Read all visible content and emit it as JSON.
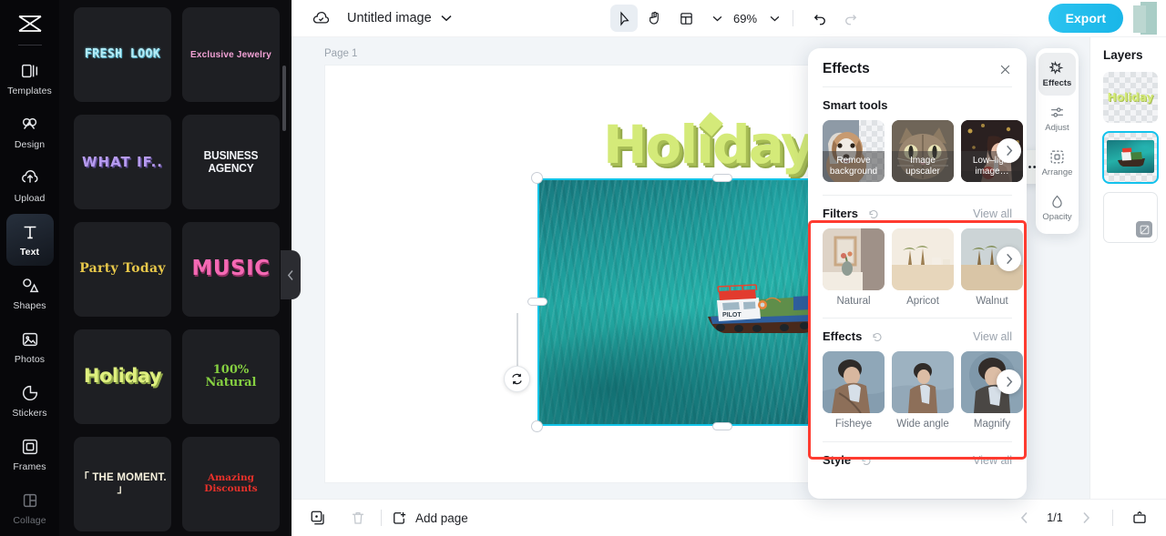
{
  "app": {
    "name": "image-editor",
    "logo_icon": "brand-logo-icon"
  },
  "sidebar": {
    "items": [
      {
        "label": "Templates",
        "icon": "templates-icon",
        "active": false
      },
      {
        "label": "Design",
        "icon": "design-icon",
        "active": false
      },
      {
        "label": "Upload",
        "icon": "upload-icon",
        "active": false
      },
      {
        "label": "Text",
        "icon": "text-icon",
        "active": true
      },
      {
        "label": "Shapes",
        "icon": "shapes-icon",
        "active": false
      },
      {
        "label": "Photos",
        "icon": "photos-icon",
        "active": false
      },
      {
        "label": "Stickers",
        "icon": "stickers-icon",
        "active": false
      },
      {
        "label": "Frames",
        "icon": "frames-icon",
        "active": false
      },
      {
        "label": "Collage",
        "icon": "collage-icon",
        "active": false
      }
    ]
  },
  "template_panel": {
    "cards": [
      {
        "text": "FRESH LOOK",
        "style": "t-fresh"
      },
      {
        "text": "Exclusive Jewelry",
        "style": "t-jewel"
      },
      {
        "text": "WHAT IF..",
        "style": "t-whatif"
      },
      {
        "text": "BUSINESS AGENCY",
        "style": "t-biz"
      },
      {
        "text": "Party Today",
        "style": "t-party"
      },
      {
        "text": "MUSIC",
        "style": "t-music"
      },
      {
        "text": "Holiday",
        "style": "t-holiday"
      },
      {
        "text": "100% Natural",
        "style": "t-natural"
      },
      {
        "text": "「 THE MOMENT. 」",
        "style": "t-moment"
      },
      {
        "text": "Amazing Discounts",
        "style": "t-discount"
      }
    ]
  },
  "topbar": {
    "cloud_icon": "cloud-save-icon",
    "title": "Untitled image",
    "title_chevron": "chevron-down-icon",
    "tools": [
      {
        "name": "select-tool",
        "icon": "cursor-icon",
        "selected": true
      },
      {
        "name": "hand-tool",
        "icon": "hand-icon",
        "selected": false
      },
      {
        "name": "layout-tool",
        "icon": "layout-icon",
        "selected": false
      }
    ],
    "zoom_level": "69%",
    "undo_icon": "undo-icon",
    "redo_icon": "redo-icon",
    "export_label": "Export",
    "shield_icon": "shield-check-icon"
  },
  "canvas": {
    "page_label": "Page 1",
    "artwork_text": "Holiday",
    "boat_text": "PILOT",
    "float_toolbar": [
      {
        "name": "crop-button",
        "icon": "crop-icon"
      },
      {
        "name": "cutout-button",
        "icon": "cutout-icon"
      },
      {
        "name": "duplicate-button",
        "icon": "duplicate-icon"
      },
      {
        "name": "more-button",
        "icon": "more-dots-icon"
      }
    ],
    "rotate_icon": "rotate-icon"
  },
  "effects_panel": {
    "title": "Effects",
    "close_icon": "close-icon",
    "sections": [
      {
        "title": "Smart tools",
        "has_reset": false,
        "view_all": null,
        "items": [
          {
            "label": "Remove background",
            "caption_overlay": true
          },
          {
            "label": "Image upscaler",
            "caption_overlay": true
          },
          {
            "label": "Low–light image…",
            "caption_overlay": true
          }
        ]
      },
      {
        "title": "Filters",
        "has_reset": true,
        "view_all": "View all",
        "items": [
          {
            "label": "Natural",
            "caption_overlay": false
          },
          {
            "label": "Apricot",
            "caption_overlay": false
          },
          {
            "label": "Walnut",
            "caption_overlay": false
          }
        ]
      },
      {
        "title": "Effects",
        "has_reset": true,
        "view_all": "View all",
        "items": [
          {
            "label": "Fisheye",
            "caption_overlay": false
          },
          {
            "label": "Wide angle",
            "caption_overlay": false
          },
          {
            "label": "Magnify",
            "caption_overlay": false
          }
        ]
      },
      {
        "title": "Style",
        "has_reset": true,
        "view_all": "View all",
        "items": []
      }
    ],
    "next_arrow_icon": "chevron-right-icon",
    "highlight_color": "#ff3b30"
  },
  "right_rail": {
    "tabs": [
      {
        "label": "Effects",
        "icon": "sparkle-icon",
        "active": true
      },
      {
        "label": "Adjust",
        "icon": "sliders-icon",
        "active": false
      },
      {
        "label": "Arrange",
        "icon": "arrange-icon",
        "active": false
      },
      {
        "label": "Opacity",
        "icon": "opacity-icon",
        "active": false
      }
    ]
  },
  "layers": {
    "title": "Layers",
    "items": [
      {
        "name": "layer-text",
        "preview_text": "Holiday",
        "selected": false
      },
      {
        "name": "layer-image",
        "preview_text": "",
        "selected": true
      },
      {
        "name": "layer-background",
        "preview_text": "",
        "selected": false
      }
    ]
  },
  "bottombar": {
    "duplicate_icon": "duplicate-page-icon",
    "delete_icon": "trash-icon",
    "add_page_label": "Add page",
    "add_page_icon": "add-page-icon",
    "prev_icon": "chevron-left-icon",
    "next_icon": "chevron-right-icon",
    "page_indicator": "1/1",
    "present_icon": "present-icon"
  },
  "colors": {
    "accent": "#19b6e8",
    "selection": "#10c4e8",
    "highlight": "#ff3b30",
    "dark_bg": "#07070a"
  }
}
